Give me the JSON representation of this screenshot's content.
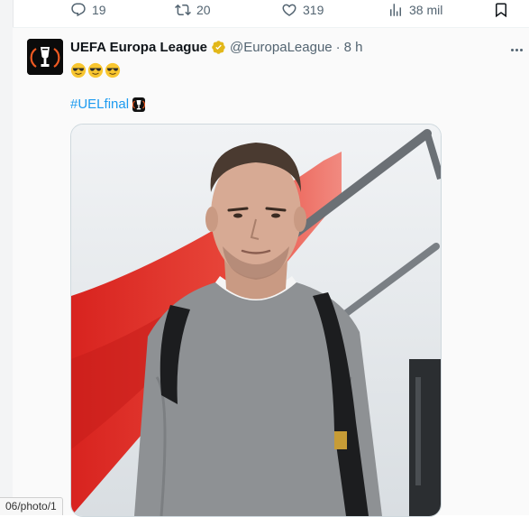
{
  "prev_tweet_actions": {
    "replies": "19",
    "reposts": "20",
    "likes": "319",
    "views": "38 mil"
  },
  "tweet": {
    "author_name": "UEFA Europa League",
    "author_handle": "@EuropaLeague",
    "separator": "·",
    "time": "8 h",
    "emoji_text": [
      "😎",
      "😎",
      "😎"
    ],
    "hashtag": "#UELfinal",
    "photo_alt_icon": "trophy-icon"
  },
  "status_bar": {
    "url_preview": "06/photo/1"
  },
  "colors": {
    "link": "#1d9bf0",
    "secondary_text": "#536471",
    "verified_gold": "#e2b719"
  }
}
